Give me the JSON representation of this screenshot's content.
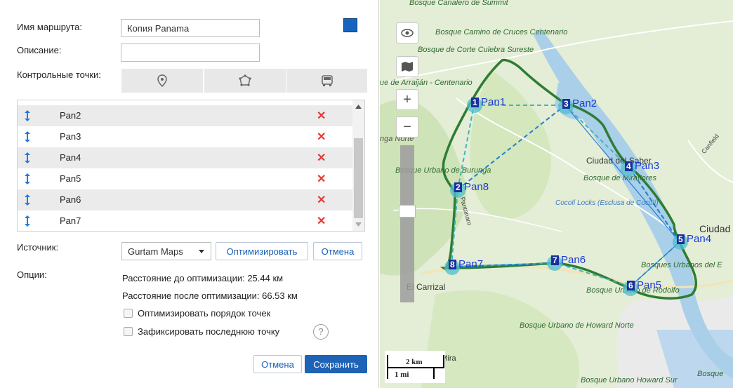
{
  "form": {
    "route_name_label": "Имя маршрута:",
    "route_name_value": "Копия Panama",
    "description_label": "Описание:",
    "description_value": "",
    "checkpoints_label": "Контрольные точки:",
    "route_color": "#1565c0",
    "toolbar": [
      {
        "icon": "marker-icon",
        "name": "tool-point"
      },
      {
        "icon": "polygon-icon",
        "name": "tool-polygon"
      },
      {
        "icon": "bus-icon",
        "name": "tool-vehicle"
      }
    ]
  },
  "points": [
    {
      "name": "Pan2"
    },
    {
      "name": "Pan3"
    },
    {
      "name": "Pan4"
    },
    {
      "name": "Pan5"
    },
    {
      "name": "Pan6"
    },
    {
      "name": "Pan7"
    }
  ],
  "source": {
    "label": "Источник:",
    "selected": "Gurtam Maps",
    "optimize_button": "Оптимизировать",
    "cancel_button": "Отмена"
  },
  "options": {
    "label": "Опции:",
    "distance_before": "Расстояние до оптимизации: 25.44 км",
    "distance_after": "Расстояние после оптимизации: 66.53 км",
    "optimize_order_label": "Оптимизировать порядок точек",
    "optimize_order_checked": false,
    "fix_last_label": "Зафиксировать последнюю точку",
    "fix_last_checked": false,
    "help": "?"
  },
  "footer": {
    "cancel": "Отмена",
    "save": "Сохранить"
  },
  "map": {
    "labels": [
      {
        "text": "Bosque Canalero de Summit"
      },
      {
        "text": "Bosque Camino de Cruces Centenario"
      },
      {
        "text": "Bosque de Corte Culebra Sureste"
      },
      {
        "text": "ue de Arraiján - Centenario"
      },
      {
        "text": "nga Norte"
      },
      {
        "text": "Ciudad del Saber"
      },
      {
        "text": "Bosque de Miraflores"
      },
      {
        "text": "Bosque Urbano de Burunga"
      },
      {
        "text": "Cocolí Locks (Esclusa de Cocolí)"
      },
      {
        "text": "Ciudad"
      },
      {
        "text": "Bosques Urbanos del E"
      },
      {
        "text": "El Carrizal"
      },
      {
        "text": "Bosque Urbano de Rodolfo"
      },
      {
        "text": "Bosque Urbano de Howard Norte"
      },
      {
        "text": "La Mira"
      },
      {
        "text": "Bosque Urbano Howard Sur"
      },
      {
        "text": "Bosque"
      },
      {
        "text": "Canfield"
      },
      {
        "text": "Pantanaro"
      }
    ],
    "markers": [
      {
        "num": "1",
        "name": "Pan1"
      },
      {
        "num": "3",
        "name": "Pan2"
      },
      {
        "num": "4",
        "name": "Pan3"
      },
      {
        "num": "5",
        "name": "Pan4"
      },
      {
        "num": "6",
        "name": "Pan5"
      },
      {
        "num": "7",
        "name": "Pan6"
      },
      {
        "num": "8",
        "name": "Pan7"
      },
      {
        "num": "2",
        "name": "Pan8"
      }
    ],
    "scale_km": "2 km",
    "scale_mi": "1 mi",
    "controls": {
      "zoom_in": "+",
      "zoom_out": "−"
    }
  }
}
